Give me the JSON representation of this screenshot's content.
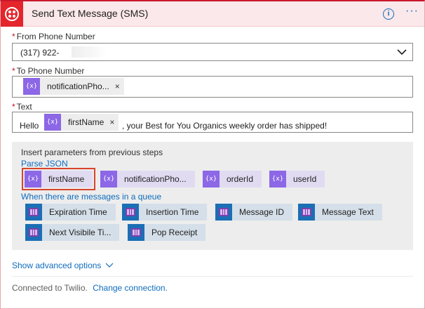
{
  "header": {
    "title": "Send Text Message (SMS)",
    "info_icon": "info-icon",
    "more_icon": "ellipsis-icon",
    "accent": "#e4252c",
    "info_glyph": "i",
    "more_glyph": "···"
  },
  "form": {
    "required_marker": "*",
    "from": {
      "label": "From Phone Number",
      "value": "(317) 922-"
    },
    "to": {
      "label": "To Phone Number",
      "token": "notificationPho..."
    },
    "text": {
      "label": "Text",
      "prefix": "Hello",
      "token": "firstName",
      "suffix": ", your Best for You Organics weekly order has shipped!"
    },
    "token_remove": "×",
    "token_icon_glyph": "{x}"
  },
  "dynamic_content": {
    "title": "Insert parameters from previous steps",
    "sections": [
      {
        "name": "Parse JSON",
        "chips": [
          "firstName",
          "notificationPho...",
          "orderId",
          "userId"
        ],
        "selected": "firstName"
      },
      {
        "name": "When there are messages in a queue",
        "chips": [
          "Expiration Time",
          "Insertion Time",
          "Message ID",
          "Message Text",
          "Next Visibile Ti...",
          "Pop Receipt"
        ]
      }
    ]
  },
  "advanced": {
    "label": "Show advanced options"
  },
  "footer": {
    "text": "Connected to Twilio.",
    "link": "Change connection."
  },
  "colors": {
    "variable_chip": "#8c67e6",
    "queue_chip": "#1a6fb5",
    "link": "#0f6cbd",
    "required": "#c50f1f"
  }
}
